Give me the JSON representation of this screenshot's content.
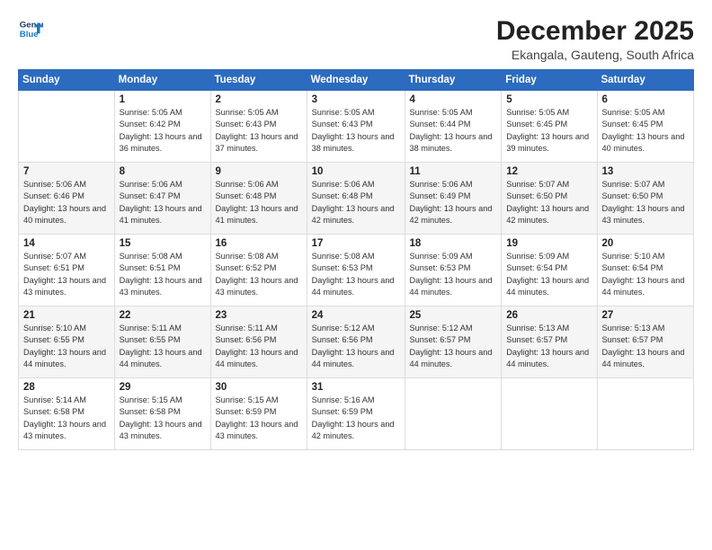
{
  "logo": {
    "line1": "General",
    "line2": "Blue"
  },
  "title": "December 2025",
  "subtitle": "Ekangala, Gauteng, South Africa",
  "days_header": [
    "Sunday",
    "Monday",
    "Tuesday",
    "Wednesday",
    "Thursday",
    "Friday",
    "Saturday"
  ],
  "weeks": [
    [
      {
        "num": "",
        "info": ""
      },
      {
        "num": "1",
        "info": "Sunrise: 5:05 AM\nSunset: 6:42 PM\nDaylight: 13 hours\nand 36 minutes."
      },
      {
        "num": "2",
        "info": "Sunrise: 5:05 AM\nSunset: 6:43 PM\nDaylight: 13 hours\nand 37 minutes."
      },
      {
        "num": "3",
        "info": "Sunrise: 5:05 AM\nSunset: 6:43 PM\nDaylight: 13 hours\nand 38 minutes."
      },
      {
        "num": "4",
        "info": "Sunrise: 5:05 AM\nSunset: 6:44 PM\nDaylight: 13 hours\nand 38 minutes."
      },
      {
        "num": "5",
        "info": "Sunrise: 5:05 AM\nSunset: 6:45 PM\nDaylight: 13 hours\nand 39 minutes."
      },
      {
        "num": "6",
        "info": "Sunrise: 5:05 AM\nSunset: 6:45 PM\nDaylight: 13 hours\nand 40 minutes."
      }
    ],
    [
      {
        "num": "7",
        "info": "Sunrise: 5:06 AM\nSunset: 6:46 PM\nDaylight: 13 hours\nand 40 minutes."
      },
      {
        "num": "8",
        "info": "Sunrise: 5:06 AM\nSunset: 6:47 PM\nDaylight: 13 hours\nand 41 minutes."
      },
      {
        "num": "9",
        "info": "Sunrise: 5:06 AM\nSunset: 6:48 PM\nDaylight: 13 hours\nand 41 minutes."
      },
      {
        "num": "10",
        "info": "Sunrise: 5:06 AM\nSunset: 6:48 PM\nDaylight: 13 hours\nand 42 minutes."
      },
      {
        "num": "11",
        "info": "Sunrise: 5:06 AM\nSunset: 6:49 PM\nDaylight: 13 hours\nand 42 minutes."
      },
      {
        "num": "12",
        "info": "Sunrise: 5:07 AM\nSunset: 6:50 PM\nDaylight: 13 hours\nand 42 minutes."
      },
      {
        "num": "13",
        "info": "Sunrise: 5:07 AM\nSunset: 6:50 PM\nDaylight: 13 hours\nand 43 minutes."
      }
    ],
    [
      {
        "num": "14",
        "info": "Sunrise: 5:07 AM\nSunset: 6:51 PM\nDaylight: 13 hours\nand 43 minutes."
      },
      {
        "num": "15",
        "info": "Sunrise: 5:08 AM\nSunset: 6:51 PM\nDaylight: 13 hours\nand 43 minutes."
      },
      {
        "num": "16",
        "info": "Sunrise: 5:08 AM\nSunset: 6:52 PM\nDaylight: 13 hours\nand 43 minutes."
      },
      {
        "num": "17",
        "info": "Sunrise: 5:08 AM\nSunset: 6:53 PM\nDaylight: 13 hours\nand 44 minutes."
      },
      {
        "num": "18",
        "info": "Sunrise: 5:09 AM\nSunset: 6:53 PM\nDaylight: 13 hours\nand 44 minutes."
      },
      {
        "num": "19",
        "info": "Sunrise: 5:09 AM\nSunset: 6:54 PM\nDaylight: 13 hours\nand 44 minutes."
      },
      {
        "num": "20",
        "info": "Sunrise: 5:10 AM\nSunset: 6:54 PM\nDaylight: 13 hours\nand 44 minutes."
      }
    ],
    [
      {
        "num": "21",
        "info": "Sunrise: 5:10 AM\nSunset: 6:55 PM\nDaylight: 13 hours\nand 44 minutes."
      },
      {
        "num": "22",
        "info": "Sunrise: 5:11 AM\nSunset: 6:55 PM\nDaylight: 13 hours\nand 44 minutes."
      },
      {
        "num": "23",
        "info": "Sunrise: 5:11 AM\nSunset: 6:56 PM\nDaylight: 13 hours\nand 44 minutes."
      },
      {
        "num": "24",
        "info": "Sunrise: 5:12 AM\nSunset: 6:56 PM\nDaylight: 13 hours\nand 44 minutes."
      },
      {
        "num": "25",
        "info": "Sunrise: 5:12 AM\nSunset: 6:57 PM\nDaylight: 13 hours\nand 44 minutes."
      },
      {
        "num": "26",
        "info": "Sunrise: 5:13 AM\nSunset: 6:57 PM\nDaylight: 13 hours\nand 44 minutes."
      },
      {
        "num": "27",
        "info": "Sunrise: 5:13 AM\nSunset: 6:57 PM\nDaylight: 13 hours\nand 44 minutes."
      }
    ],
    [
      {
        "num": "28",
        "info": "Sunrise: 5:14 AM\nSunset: 6:58 PM\nDaylight: 13 hours\nand 43 minutes."
      },
      {
        "num": "29",
        "info": "Sunrise: 5:15 AM\nSunset: 6:58 PM\nDaylight: 13 hours\nand 43 minutes."
      },
      {
        "num": "30",
        "info": "Sunrise: 5:15 AM\nSunset: 6:59 PM\nDaylight: 13 hours\nand 43 minutes."
      },
      {
        "num": "31",
        "info": "Sunrise: 5:16 AM\nSunset: 6:59 PM\nDaylight: 13 hours\nand 42 minutes."
      },
      {
        "num": "",
        "info": ""
      },
      {
        "num": "",
        "info": ""
      },
      {
        "num": "",
        "info": ""
      }
    ]
  ]
}
